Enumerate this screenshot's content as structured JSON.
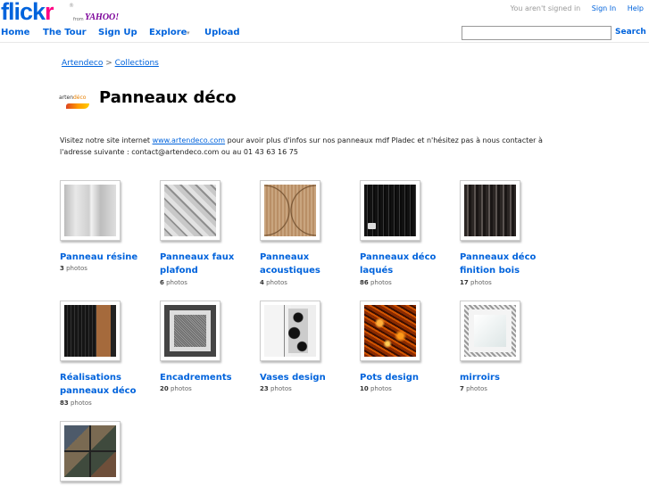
{
  "header": {
    "logo_flick": "flick",
    "logo_r": "r",
    "logo_from": "from",
    "logo_yahoo": "YAHOO!",
    "not_signed_in": "You aren't signed in",
    "signin_label": "Sign In",
    "help_label": "Help"
  },
  "nav": {
    "home": "Home",
    "tour": "The Tour",
    "signup": "Sign Up",
    "explore": "Explore",
    "explore_caret": "▾",
    "upload": "Upload",
    "search_value": "",
    "search_button": "Search"
  },
  "breadcrumb": {
    "owner": "Artendeco",
    "sep": ">",
    "section": "Collections"
  },
  "collection": {
    "logo_a": "arten",
    "logo_b": "déco",
    "title": "Panneaux déco",
    "desc_before": "Visitez notre site internet ",
    "desc_link": "www.artendeco.com",
    "desc_after": " pour avoir plus d'infos sur nos panneaux mdf Pladec et n'hésitez pas à nous contacter à l'adresse suivante : contact@artendeco.com ou au 01 43 63 16 75"
  },
  "sets": [
    {
      "title": "Panneau résine",
      "count": "3",
      "unit": "photos"
    },
    {
      "title": "Panneaux faux plafond",
      "count": "6",
      "unit": "photos"
    },
    {
      "title": "Panneaux acoustiques",
      "count": "4",
      "unit": "photos"
    },
    {
      "title": "Panneaux déco laqués",
      "count": "86",
      "unit": "photos"
    },
    {
      "title": "Panneaux déco finition bois",
      "count": "17",
      "unit": "photos"
    },
    {
      "title": "Réalisations panneaux déco",
      "count": "83",
      "unit": "photos"
    },
    {
      "title": "Encadrements",
      "count": "20",
      "unit": "photos"
    },
    {
      "title": "Vases design",
      "count": "23",
      "unit": "photos"
    },
    {
      "title": "Pots design",
      "count": "10",
      "unit": "photos"
    },
    {
      "title": "mirroirs",
      "count": "7",
      "unit": "photos"
    }
  ],
  "colors": {
    "link": "#0063dc",
    "flickr_pink": "#ff0084",
    "yahoo_purple": "#7b0099"
  }
}
